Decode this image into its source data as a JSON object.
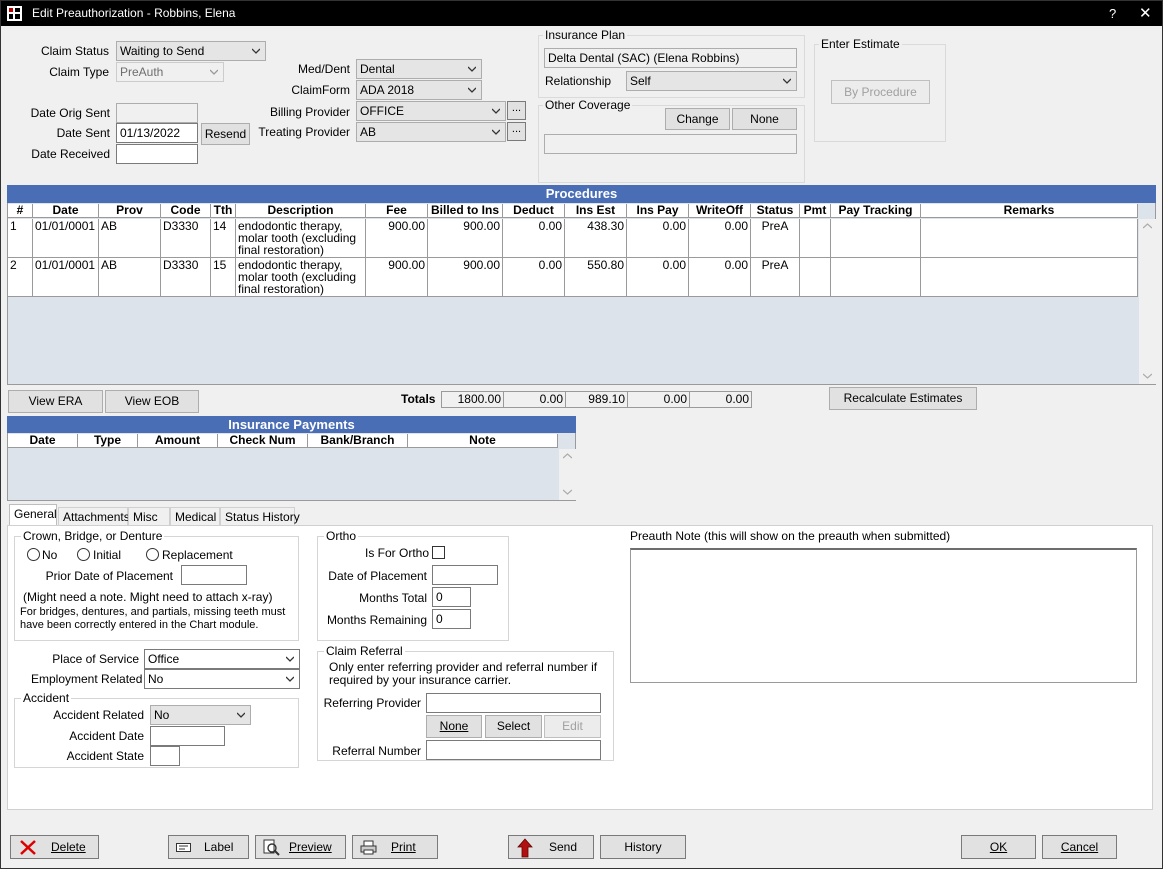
{
  "window": {
    "title": "Edit Preauthorization - Robbins, Elena",
    "help": "?",
    "close": "✕"
  },
  "claim": {
    "status_label": "Claim Status",
    "status_value": "Waiting to Send",
    "type_label": "Claim Type",
    "type_value": "PreAuth",
    "date_orig_sent_label": "Date Orig Sent",
    "date_orig_sent_value": "",
    "date_sent_label": "Date Sent",
    "date_sent_value": "01/13/2022",
    "resend_label": "Resend",
    "date_received_label": "Date Received",
    "date_received_value": ""
  },
  "meddent": {
    "label": "Med/Dent",
    "value": "Dental",
    "claimform_label": "ClaimForm",
    "claimform_value": "ADA 2018",
    "billing_label": "Billing Provider",
    "billing_value": "OFFICE",
    "treating_label": "Treating Provider",
    "treating_value": "AB",
    "ellipsis": "..."
  },
  "insurance_plan": {
    "title": "Insurance Plan",
    "plan_value": "Delta Dental (SAC) (Elena Robbins)",
    "relationship_label": "Relationship",
    "relationship_value": "Self",
    "other_coverage_title": "Other Coverage",
    "change_label": "Change",
    "none_label": "None",
    "other_value": ""
  },
  "estimate": {
    "title": "Enter Estimate",
    "by_procedure_label": "By Procedure"
  },
  "procedures": {
    "title": "Procedures",
    "columns": [
      "#",
      "Date",
      "Prov",
      "Code",
      "Tth",
      "Description",
      "Fee",
      "Billed to Ins",
      "Deduct",
      "Ins Est",
      "Ins Pay",
      "WriteOff",
      "Status",
      "Pmt",
      "Pay Tracking",
      "Remarks"
    ],
    "rows": [
      {
        "num": "1",
        "date": "01/01/0001",
        "prov": "AB",
        "code": "D3330",
        "tth": "14",
        "desc": "endodontic therapy, molar tooth (excluding final restoration)",
        "fee": "900.00",
        "billed": "900.00",
        "deduct": "0.00",
        "insest": "438.30",
        "inspay": "0.00",
        "writeoff": "0.00",
        "status": "PreA",
        "pmt": "",
        "paytrack": "",
        "remarks": ""
      },
      {
        "num": "2",
        "date": "01/01/0001",
        "prov": "AB",
        "code": "D3330",
        "tth": "15",
        "desc": "endodontic therapy, molar tooth (excluding final restoration)",
        "fee": "900.00",
        "billed": "900.00",
        "deduct": "0.00",
        "insest": "550.80",
        "inspay": "0.00",
        "writeoff": "0.00",
        "status": "PreA",
        "pmt": "",
        "paytrack": "",
        "remarks": ""
      }
    ],
    "totals_label": "Totals",
    "totals": {
      "fee": "1800.00",
      "deduct": "0.00",
      "insest": "989.10",
      "inspay": "0.00",
      "writeoff": "0.00"
    },
    "recalc_label": "Recalculate Estimates"
  },
  "era": {
    "view_era": "View ERA",
    "view_eob": "View EOB"
  },
  "payments": {
    "title": "Insurance Payments",
    "columns": [
      "Date",
      "Type",
      "Amount",
      "Check Num",
      "Bank/Branch",
      "Note"
    ]
  },
  "tabs": [
    "General",
    "Attachments",
    "Misc",
    "Medical",
    "Status History"
  ],
  "crown": {
    "title": "Crown, Bridge, or Denture",
    "opt_no": "No",
    "opt_initial": "Initial",
    "opt_replacement": "Replacement",
    "prior_label": "Prior Date of Placement",
    "prior_value": "",
    "note1": "(Might need a note. Might need to attach x-ray)",
    "note2": "For bridges, dentures, and partials, missing teeth must have been correctly entered in the Chart module."
  },
  "place": {
    "pos_label": "Place of Service",
    "pos_value": "Office",
    "emp_label": "Employment Related",
    "emp_value": "No"
  },
  "accident": {
    "title": "Accident",
    "related_label": "Accident Related",
    "related_value": "No",
    "date_label": "Accident Date",
    "date_value": "",
    "state_label": "Accident State",
    "state_value": ""
  },
  "ortho": {
    "title": "Ortho",
    "is_for_label": "Is For Ortho",
    "placement_label": "Date of Placement",
    "placement_value": "",
    "months_total_label": "Months Total",
    "months_total_value": "0",
    "months_remaining_label": "Months Remaining",
    "months_remaining_value": "0"
  },
  "referral": {
    "title": "Claim Referral",
    "note": "Only enter referring provider and referral number if required by your insurance carrier.",
    "provider_label": "Referring Provider",
    "provider_value": "",
    "none_label": "None",
    "select_label": "Select",
    "edit_label": "Edit",
    "number_label": "Referral Number",
    "number_value": ""
  },
  "preauth_note": {
    "label": "Preauth Note (this will show on the preauth when submitted)",
    "value": ""
  },
  "bottom": {
    "delete": "Delete",
    "label": "Label",
    "preview": "Preview",
    "print": "Print",
    "send": "Send",
    "history": "History",
    "ok": "OK",
    "cancel": "Cancel"
  }
}
